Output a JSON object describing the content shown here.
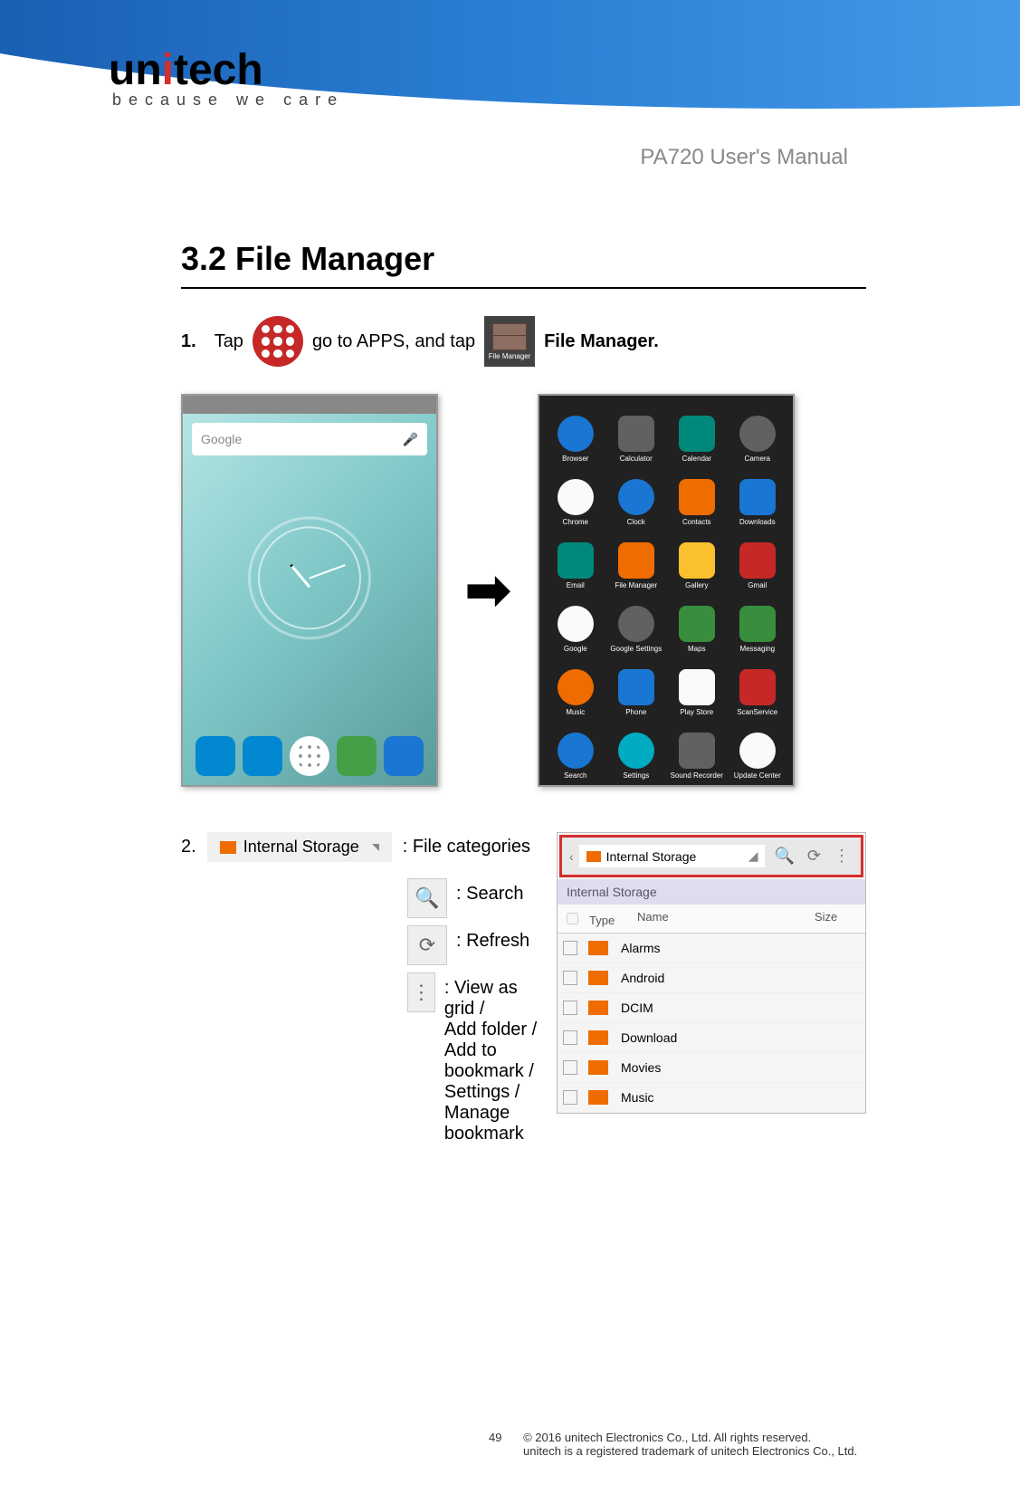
{
  "brand": {
    "name_part1": "un",
    "name_dot": "i",
    "name_part2": "tech",
    "tagline": "because we care"
  },
  "manual_title": "PA720 User's Manual",
  "section_heading": "3.2 File Manager",
  "step1": {
    "num": "1.",
    "text_a": "Tap",
    "text_b": "go to APPS, and tap",
    "fm_icon_label": "File Manager",
    "text_c": "File Manager."
  },
  "home_screen": {
    "search_placeholder": "Google"
  },
  "apps_screen": {
    "items": [
      {
        "label": "Browser",
        "cls": "ic-blue ic-round"
      },
      {
        "label": "Calculator",
        "cls": "ic-gray"
      },
      {
        "label": "Calendar",
        "cls": "ic-teal"
      },
      {
        "label": "Camera",
        "cls": "ic-gray ic-round"
      },
      {
        "label": "Chrome",
        "cls": "ic-white ic-round"
      },
      {
        "label": "Clock",
        "cls": "ic-blue ic-round"
      },
      {
        "label": "Contacts",
        "cls": "ic-orange"
      },
      {
        "label": "Downloads",
        "cls": "ic-blue"
      },
      {
        "label": "Email",
        "cls": "ic-teal"
      },
      {
        "label": "File Manager",
        "cls": "ic-orange"
      },
      {
        "label": "Gallery",
        "cls": "ic-yellow"
      },
      {
        "label": "Gmail",
        "cls": "ic-red"
      },
      {
        "label": "Google",
        "cls": "ic-white ic-round"
      },
      {
        "label": "Google Settings",
        "cls": "ic-gray ic-round"
      },
      {
        "label": "Maps",
        "cls": "ic-green"
      },
      {
        "label": "Messaging",
        "cls": "ic-green"
      },
      {
        "label": "Music",
        "cls": "ic-orange ic-round"
      },
      {
        "label": "Phone",
        "cls": "ic-blue"
      },
      {
        "label": "Play Store",
        "cls": "ic-white"
      },
      {
        "label": "ScanService",
        "cls": "ic-red"
      },
      {
        "label": "Search",
        "cls": "ic-blue ic-round"
      },
      {
        "label": "Settings",
        "cls": "ic-cyan ic-round"
      },
      {
        "label": "Sound Recorder",
        "cls": "ic-gray"
      },
      {
        "label": "Update Center",
        "cls": "ic-white ic-round"
      }
    ]
  },
  "step2": {
    "num": "2.",
    "internal_storage_label": "Internal Storage",
    "file_categories": ": File categories",
    "search": ": Search",
    "refresh": ": Refresh",
    "more": ": View as grid /\nAdd folder /\nAdd to bookmark /\nSettings /\nManage bookmark"
  },
  "file_manager_shot": {
    "top_button": "Internal Storage",
    "breadcrumb": "Internal Storage",
    "cols": {
      "c1": "Type",
      "c2": "Name",
      "c3": "Size"
    },
    "rows": [
      "Alarms",
      "Android",
      "DCIM",
      "Download",
      "Movies",
      "Music"
    ]
  },
  "footer": {
    "page": "49",
    "line1": "© 2016 unitech Electronics Co., Ltd. All rights reserved.",
    "line2": "unitech is a registered trademark of unitech Electronics Co., Ltd."
  }
}
